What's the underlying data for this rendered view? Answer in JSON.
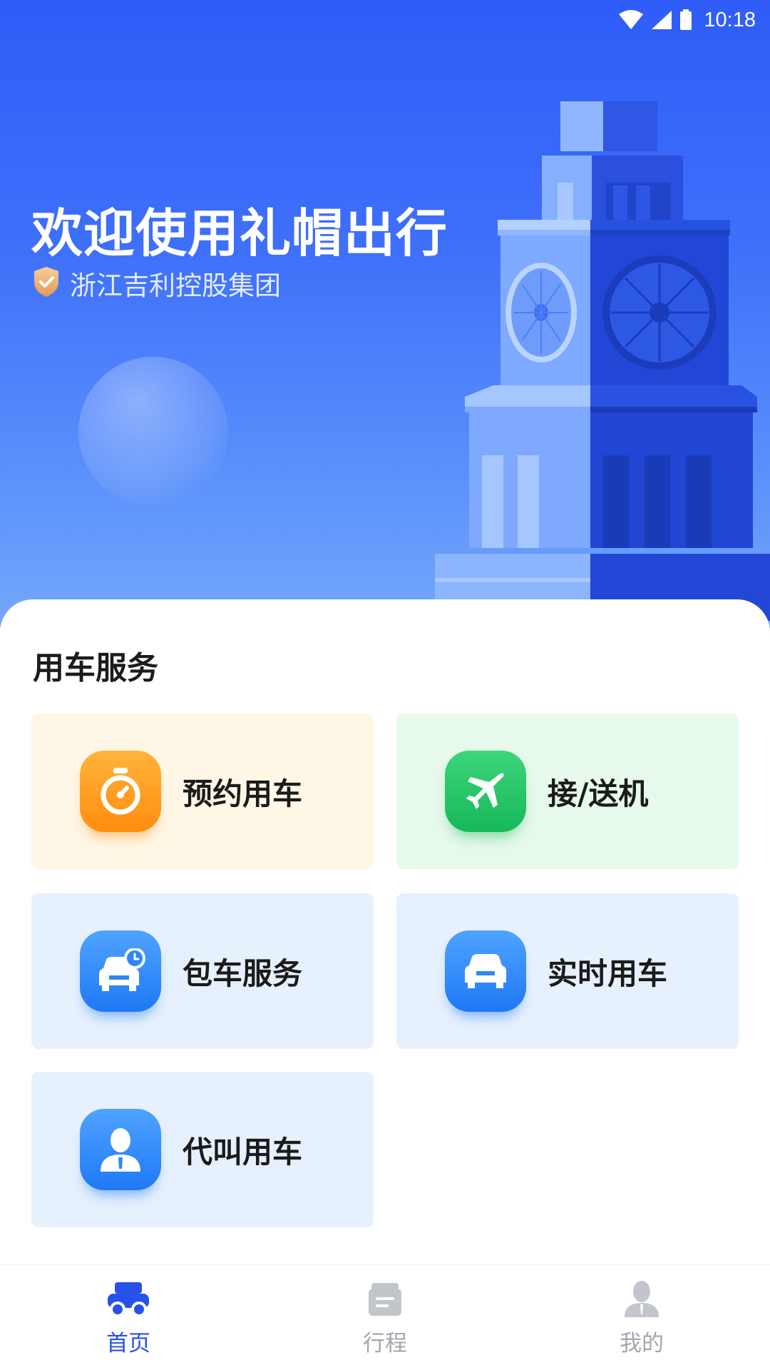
{
  "status_bar": {
    "time": "10:18",
    "icons": [
      "wifi-icon",
      "signal-icon",
      "battery-icon"
    ]
  },
  "hero": {
    "title": "欢迎使用礼帽出行",
    "subtitle": "浙江吉利控股集团",
    "subtitle_icon": "shield-check-icon"
  },
  "services": {
    "title": "用车服务",
    "items": [
      {
        "label": "预约用车",
        "icon": "stopwatch-icon",
        "color": "#ff9a1f"
      },
      {
        "label": "接/送机",
        "icon": "airplane-icon",
        "color": "#1fc263"
      },
      {
        "label": "包车服务",
        "icon": "car-clock-icon",
        "color": "#2b86f8"
      },
      {
        "label": "实时用车",
        "icon": "car-icon",
        "color": "#2b86f8"
      },
      {
        "label": "代叫用车",
        "icon": "person-icon",
        "color": "#2b86f8"
      }
    ]
  },
  "tabbar": {
    "items": [
      {
        "label": "首页",
        "icon": "car-home-icon",
        "active": true
      },
      {
        "label": "行程",
        "icon": "trip-list-icon",
        "active": false
      },
      {
        "label": "我的",
        "icon": "user-profile-icon",
        "active": false
      }
    ],
    "active_color": "#2751e8",
    "inactive_color": "#a3a6ad"
  },
  "colors": {
    "hero_top": "#2f5cf8",
    "hero_bottom": "#74a7fb"
  }
}
